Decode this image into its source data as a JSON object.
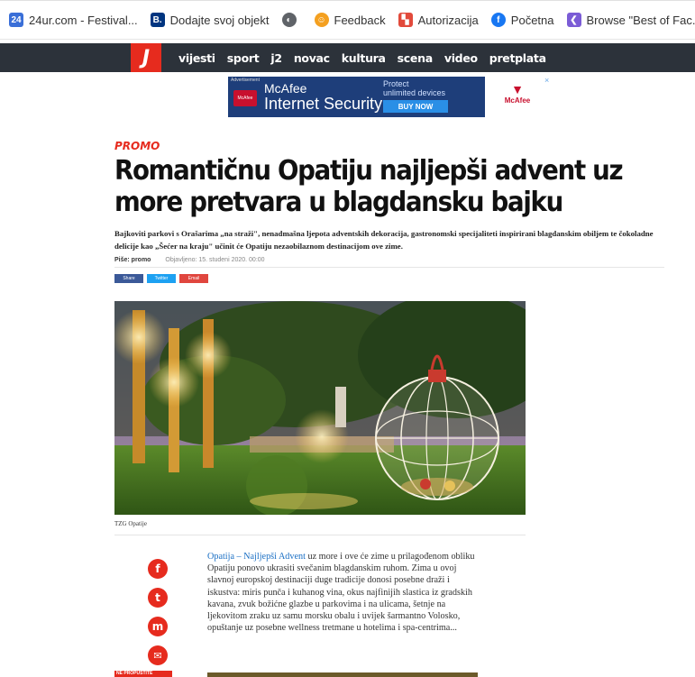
{
  "bookmarks": [
    {
      "label": "24ur.com - Festival...",
      "icon": "24ur-icon",
      "icon_text": "24",
      "color": "#3a6fd8"
    },
    {
      "label": "Dodajte svoj objekt",
      "icon": "booking-icon",
      "icon_text": "B.",
      "color": "#003580"
    },
    {
      "label": "",
      "icon": "globe-icon",
      "icon_text": "◐",
      "color": "#5f6368"
    },
    {
      "label": "Feedback",
      "icon": "feedback-icon",
      "icon_text": "☺",
      "color": "#f4a020"
    },
    {
      "label": "Autorizacija",
      "icon": "autorizacija-icon",
      "icon_text": "▚",
      "color": "#e24a3b"
    },
    {
      "label": "Početna",
      "icon": "facebook-icon",
      "icon_text": "f",
      "color": "#1877f2"
    },
    {
      "label": "Browse \"Best of Fac...",
      "icon": "browse-icon",
      "icon_text": "❮",
      "color": "#7b5cd6"
    },
    {
      "label": "",
      "icon": "eu-icon",
      "icon_text": "★",
      "color": "#1f3fa0"
    }
  ],
  "site": {
    "logo": "J",
    "nav": [
      "vijesti",
      "sport",
      "j2",
      "novac",
      "kultura",
      "scena",
      "video",
      "pretplata"
    ]
  },
  "ad": {
    "label": "Advertisement",
    "badge": "McAfee",
    "brand": "McAfee",
    "product": "Internet Security",
    "tagline1": "Protect",
    "tagline2": "unlimited devices",
    "cta": "BUY NOW",
    "logo_text": "McAfee",
    "close": "×"
  },
  "article": {
    "kicker": "PROMO",
    "title": "Romantičnu Opatiju najljepši advent uz more pretvara u blagdansku bajku",
    "lead": "Bajkoviti parkovi s Orašarima „na straži\", nenadmašna ljepota adventskih dekoracija, gastronomski specijaliteti inspirirani blagdanskim obiljem te čokoladne delicije kao „Šećer na kraju\" učinit će Opatiju nezaobilaznom destinacijom ove zime.",
    "byline_label": "Piše: promo",
    "published": "Objavljeno: 15. studeni 2020. 00:00",
    "share": {
      "facebook": "Share",
      "twitter": "Twitter",
      "email": "Email"
    },
    "caption": "TZG Opatije",
    "body_link": "Opatija – Najljepši Advent",
    "body_text": " uz more i ove će zime u prilagođenom obliku Opatiju ponovo ukrasiti svečanim blagdanskim ruhom. Zima u ovoj slavnoj europskoj destinaciji duge tradicije donosi posebne draži i iskustva: miris punča i kuhanog vina, okus najfinijih slastica iz gradskih kavana, zvuk božićne glazbe u parkovima i na ulicama, šetnje na ljekovitom zraku uz samu morsku obalu i uvijek šarmantno Volosko, opuštanje uz posebne wellness tretmane u hotelima i spa-centrima...",
    "next_tag": "NE PROPUSTITE",
    "social": {
      "facebook": "f",
      "twitter": "t",
      "messenger": "m",
      "email": "✉"
    }
  },
  "colors": {
    "accent": "#e62b1e",
    "nav_bg": "#2c323a",
    "link": "#1a6fc4"
  }
}
